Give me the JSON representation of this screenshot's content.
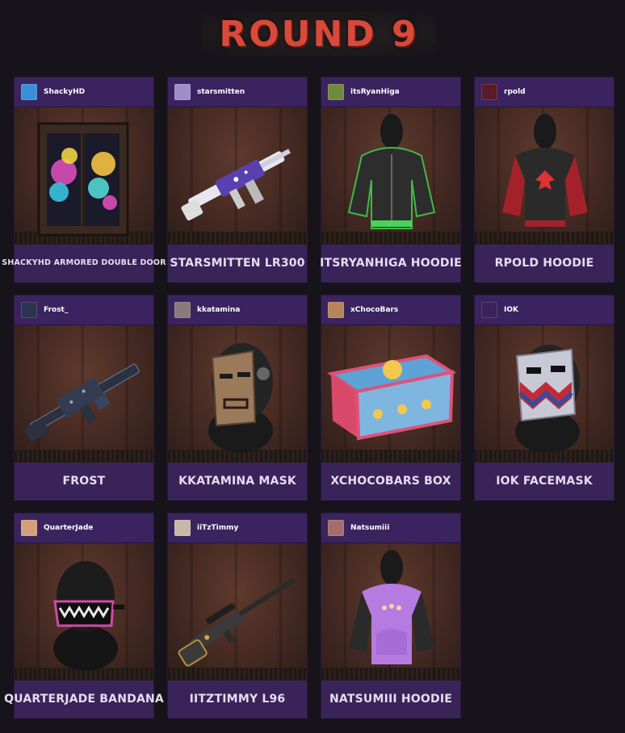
{
  "page": {
    "title": "ROUND 9"
  },
  "items": [
    {
      "username": "ShackyHD",
      "name": "SHACKYHD ARMORED DOUBLE DOOR",
      "avatar_color": "#3a8fd6",
      "icon": "double-door-icon"
    },
    {
      "username": "starsmitten",
      "name": "STARSMITTEN LR300",
      "avatar_color": "#9d8ec9",
      "icon": "rifle-icon"
    },
    {
      "username": "itsRyanHiga",
      "name": "ITSRYANHIGA HOODIE",
      "avatar_color": "#6f8a3a",
      "icon": "hoodie-icon"
    },
    {
      "username": "rpold",
      "name": "RPOLD HOODIE",
      "avatar_color": "#5a1a2a",
      "icon": "hoodie-icon"
    },
    {
      "username": "Frost_",
      "name": "FROST",
      "avatar_color": "#2c3550",
      "icon": "machine-gun-icon"
    },
    {
      "username": "kkatamina",
      "name": "KKATAMINA MASK",
      "avatar_color": "#8a7a7a",
      "icon": "mask-icon"
    },
    {
      "username": "xChocoBars",
      "name": "XCHOCOBARS BOX",
      "avatar_color": "#b7845a",
      "icon": "box-icon"
    },
    {
      "username": "IOK",
      "name": "IOK FACEMASK",
      "avatar_color": "#3a2358",
      "icon": "facemask-icon"
    },
    {
      "username": "QuarterJade",
      "name": "QUARTERJADE BANDANA",
      "avatar_color": "#d2a07a",
      "icon": "bandana-icon"
    },
    {
      "username": "iiTzTimmy",
      "name": "IITZTIMMY L96",
      "avatar_color": "#c9b8a8",
      "icon": "sniper-rifle-icon"
    },
    {
      "username": "Natsumiii",
      "name": "NATSUMIII HOODIE",
      "avatar_color": "#a36f6a",
      "icon": "hoodie-icon"
    }
  ]
}
